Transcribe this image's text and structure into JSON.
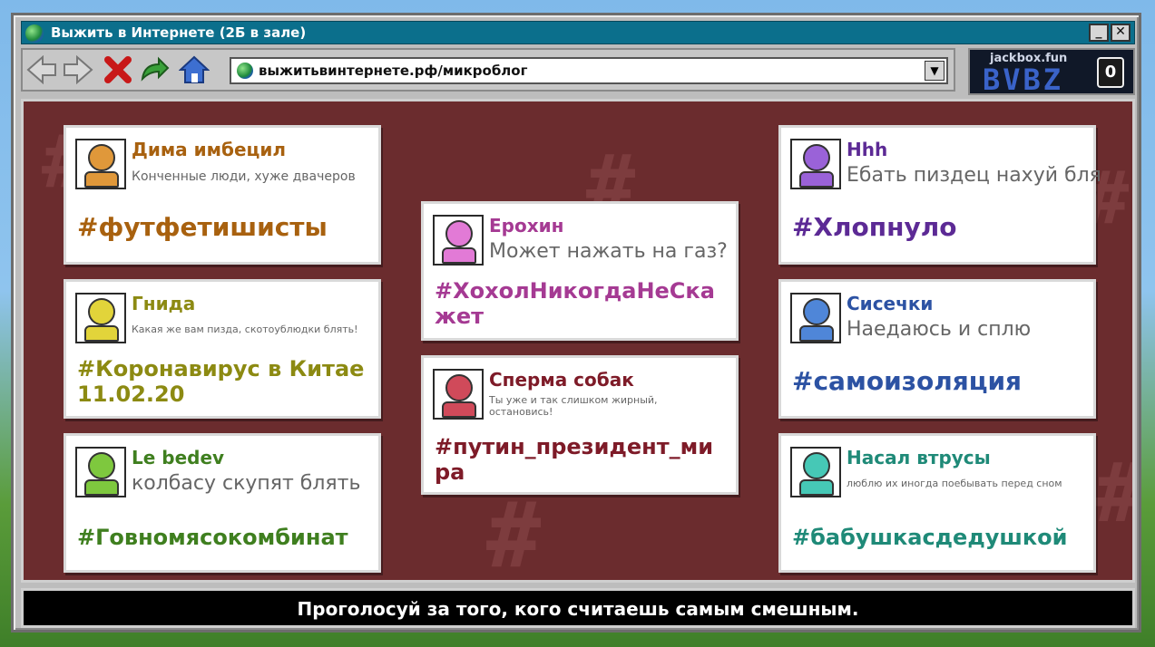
{
  "window": {
    "title": "Выжить в Интернете  (2Б в зале)",
    "minimize_label": "_",
    "close_label": "✕"
  },
  "toolbar": {
    "icons": [
      "back-arrow-icon",
      "forward-arrow-icon",
      "stop-x-icon",
      "refresh-arrow-icon",
      "home-icon"
    ],
    "address": "выжитьвинтернете.рф/микроблог",
    "dropdown_glyph": "▼"
  },
  "brand": {
    "site": "jackbox.fun",
    "room_code": "BVBZ",
    "audience_count": "0"
  },
  "posts": [
    {
      "name": "Дима имбецил",
      "message": "Конченные люди, хуже двачеров",
      "tag": "#футфетишисты",
      "color": "#a8610f",
      "avatar_color": "#e0983a"
    },
    {
      "name": "Гнида",
      "message": "Какая же вам пизда, скотоублюдки блять!",
      "tag": "#Коронавирус в Китае 11.02.20",
      "color": "#8c8a12",
      "avatar_color": "#e2d43a"
    },
    {
      "name": "Le bedev",
      "message": "колбасу скупят блять",
      "tag": "#Говномясокомбинат",
      "color": "#3f7f1f",
      "avatar_color": "#7ec83e"
    },
    {
      "name": "Ерохин",
      "message": "Может нажать на газ?",
      "tag": "#ХохолНикогдаНеСкажет",
      "color": "#a53a93",
      "avatar_color": "#e27ad6"
    },
    {
      "name": "Сперма собак",
      "message": "Ты уже и так слишком жирный, остановись!",
      "tag": "#путин_президент_мира",
      "color": "#7e1b28",
      "avatar_color": "#d04a5a"
    },
    {
      "name": "Hhh",
      "message": "Ебать пиздец нахуй бля",
      "tag": "#Хлопнуло",
      "color": "#5c2a95",
      "avatar_color": "#9a62d8"
    },
    {
      "name": "Сисечки",
      "message": "Наедаюсь и сплю",
      "tag": "#самоизоляция",
      "color": "#2c52a3",
      "avatar_color": "#4f86d8"
    },
    {
      "name": "Насал втрусы",
      "message": "люблю их иногда поебывать перед сном",
      "tag": "#бабушкасдедушкой",
      "color": "#1f8a78",
      "avatar_color": "#46c8b6"
    }
  ],
  "footer": {
    "instruction": "Проголосуй за того, кого считаешь самым смешным."
  },
  "colors": {
    "board_bg": "#6b2c2e",
    "titlebar": "#0b6f8c"
  }
}
